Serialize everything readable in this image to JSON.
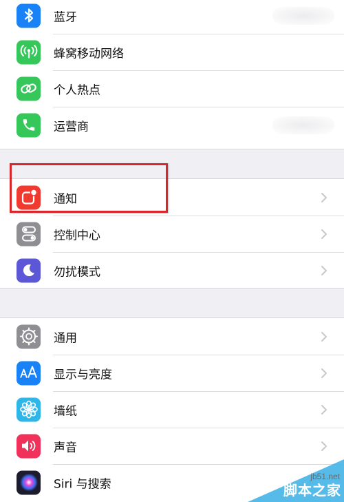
{
  "groups": [
    {
      "items": [
        {
          "label": "蓝牙",
          "icon": "bluetooth-icon",
          "color": "#1a82f7",
          "chevron": false
        },
        {
          "label": "蜂窝移动网络",
          "icon": "cellular-icon",
          "color": "#35c759",
          "chevron": false
        },
        {
          "label": "个人热点",
          "icon": "hotspot-icon",
          "color": "#35c759",
          "chevron": false
        },
        {
          "label": "运营商",
          "icon": "phone-icon",
          "color": "#35c759",
          "chevron": false
        }
      ]
    },
    {
      "items": [
        {
          "label": "通知",
          "icon": "notifications-icon",
          "color": "#f03a30",
          "chevron": true,
          "highlighted": true
        },
        {
          "label": "控制中心",
          "icon": "control-center-icon",
          "color": "#8e8e93",
          "chevron": true
        },
        {
          "label": "勿扰模式",
          "icon": "moon-icon",
          "color": "#5b57d6",
          "chevron": true
        }
      ]
    },
    {
      "items": [
        {
          "label": "通用",
          "icon": "gear-icon",
          "color": "#8e8e93",
          "chevron": true
        },
        {
          "label": "显示与亮度",
          "icon": "display-brightness-icon",
          "color": "#1a82f7",
          "chevron": true
        },
        {
          "label": "墙纸",
          "icon": "wallpaper-icon",
          "color": "#2fb6e8",
          "chevron": true
        },
        {
          "label": "声音",
          "icon": "sound-icon",
          "color": "#f0325a",
          "chevron": true
        },
        {
          "label": "Siri 与搜索",
          "icon": "siri-icon",
          "color": "#1c1c2e",
          "chevron": false
        }
      ]
    }
  ],
  "watermark": {
    "site": "jb51.net",
    "text": "脚本之家"
  }
}
